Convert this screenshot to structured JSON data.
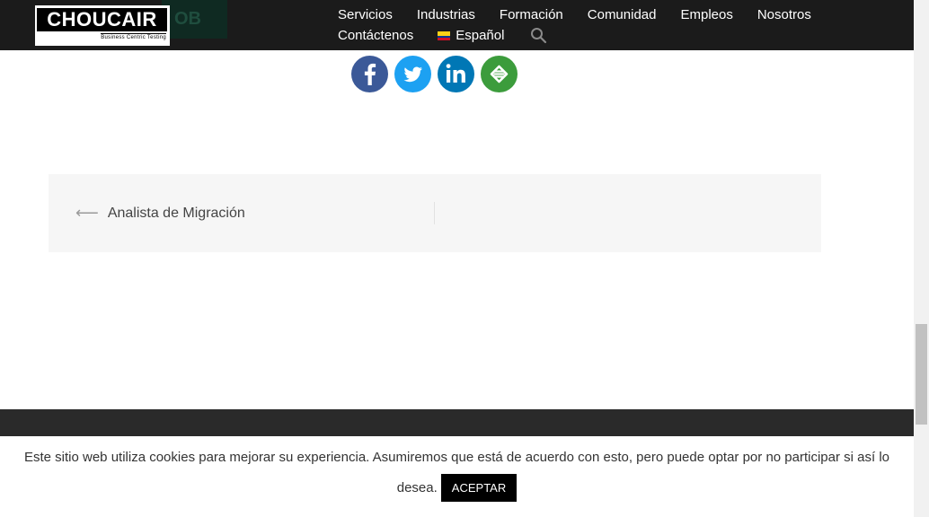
{
  "header": {
    "apply_button_fragment": "OB",
    "logo": {
      "brand": "CHOUCAIR",
      "tagline": "Business Centric Testing"
    },
    "nav_row1": [
      "Servicios",
      "Industrias",
      "Formación",
      "Comunidad",
      "Empleos",
      "Nosotros"
    ],
    "nav_row2": {
      "contact": "Contáctenos",
      "language": "Español",
      "language_flag": "colombia-flag-icon"
    }
  },
  "share": [
    {
      "icon": "facebook-icon",
      "color": "#3b5998"
    },
    {
      "icon": "twitter-icon",
      "color": "#1da1f2"
    },
    {
      "icon": "linkedin-icon",
      "color": "#0077b5"
    },
    {
      "icon": "more-share-icon",
      "color": "#3c9c3c"
    }
  ],
  "post_navigation": {
    "previous_title": "Analista de Migración"
  },
  "cookie_notice": {
    "line1": "Este sitio web utiliza cookies para mejorar su experiencia. Asumiremos que está de acuerdo con esto, pero puede optar por no participar si así lo",
    "line2": "desea.",
    "accept_label": "ACEPTAR"
  },
  "colors": {
    "header_bg": "#1b1b1b",
    "footer_bg": "#2a2a2a",
    "post_nav_bg": "#f6f6f6"
  }
}
